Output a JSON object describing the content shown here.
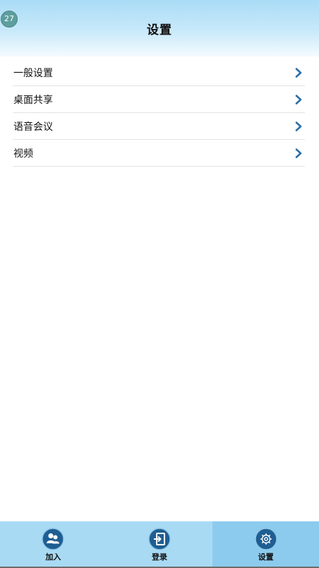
{
  "notification_badge": "27",
  "header": {
    "title": "设置"
  },
  "settings": {
    "items": [
      {
        "label": "一般设置",
        "icon": "chevron-right-icon"
      },
      {
        "label": "桌面共享",
        "icon": "chevron-right-icon"
      },
      {
        "label": "语音会议",
        "icon": "chevron-right-icon"
      },
      {
        "label": "视频",
        "icon": "chevron-right-icon"
      }
    ]
  },
  "tabbar": {
    "tabs": [
      {
        "label": "加入",
        "icon": "join-users-icon",
        "active": false
      },
      {
        "label": "登录",
        "icon": "login-icon",
        "active": false
      },
      {
        "label": "设置",
        "icon": "settings-gear-icon",
        "active": true
      }
    ]
  },
  "colors": {
    "header_top": "#a9dcf6",
    "tabbar_bg": "#a9daf4",
    "tab_active_bg": "#8ccbee",
    "icon_circle": "#1f5e92",
    "chevron": "#2b6fa8"
  }
}
